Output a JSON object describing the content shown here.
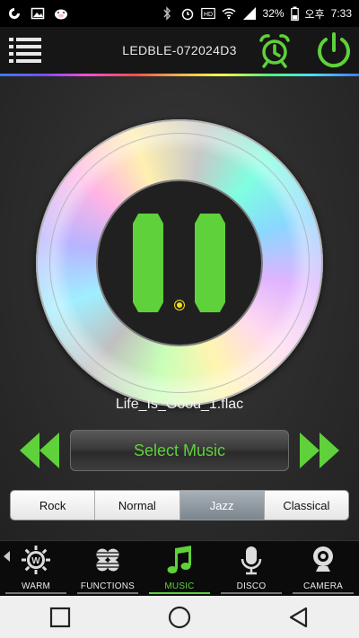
{
  "status_bar": {
    "battery": "32%",
    "ampm": "오후",
    "time": "7:33",
    "left_icons": [
      "carrier-icon",
      "image-icon",
      "pig-icon"
    ],
    "right_icons": [
      "bluetooth-icon",
      "alarm-icon",
      "hd-icon",
      "wifi-icon",
      "signal-icon",
      "battery-icon"
    ]
  },
  "header": {
    "device_name": "LEDBLE-072024D3"
  },
  "player": {
    "track_name": "Life_Is_Good_1.flac",
    "select_music_label": "Select Music",
    "state": "playing"
  },
  "equalizer": {
    "presets": [
      "Rock",
      "Normal",
      "Jazz",
      "Classical"
    ],
    "selected": "Jazz"
  },
  "tabs": [
    {
      "label": "WARM",
      "icon": "warm-icon"
    },
    {
      "label": "FUNCTIONS",
      "icon": "functions-icon"
    },
    {
      "label": "MUSIC",
      "icon": "music-note-icon"
    },
    {
      "label": "DISCO",
      "icon": "microphone-icon"
    },
    {
      "label": "CAMERA",
      "icon": "webcam-icon"
    }
  ],
  "active_tab": "MUSIC",
  "colors": {
    "accent": "#5fd13b",
    "center_dot": "#f1e10f",
    "background": "#2b2b2b"
  }
}
